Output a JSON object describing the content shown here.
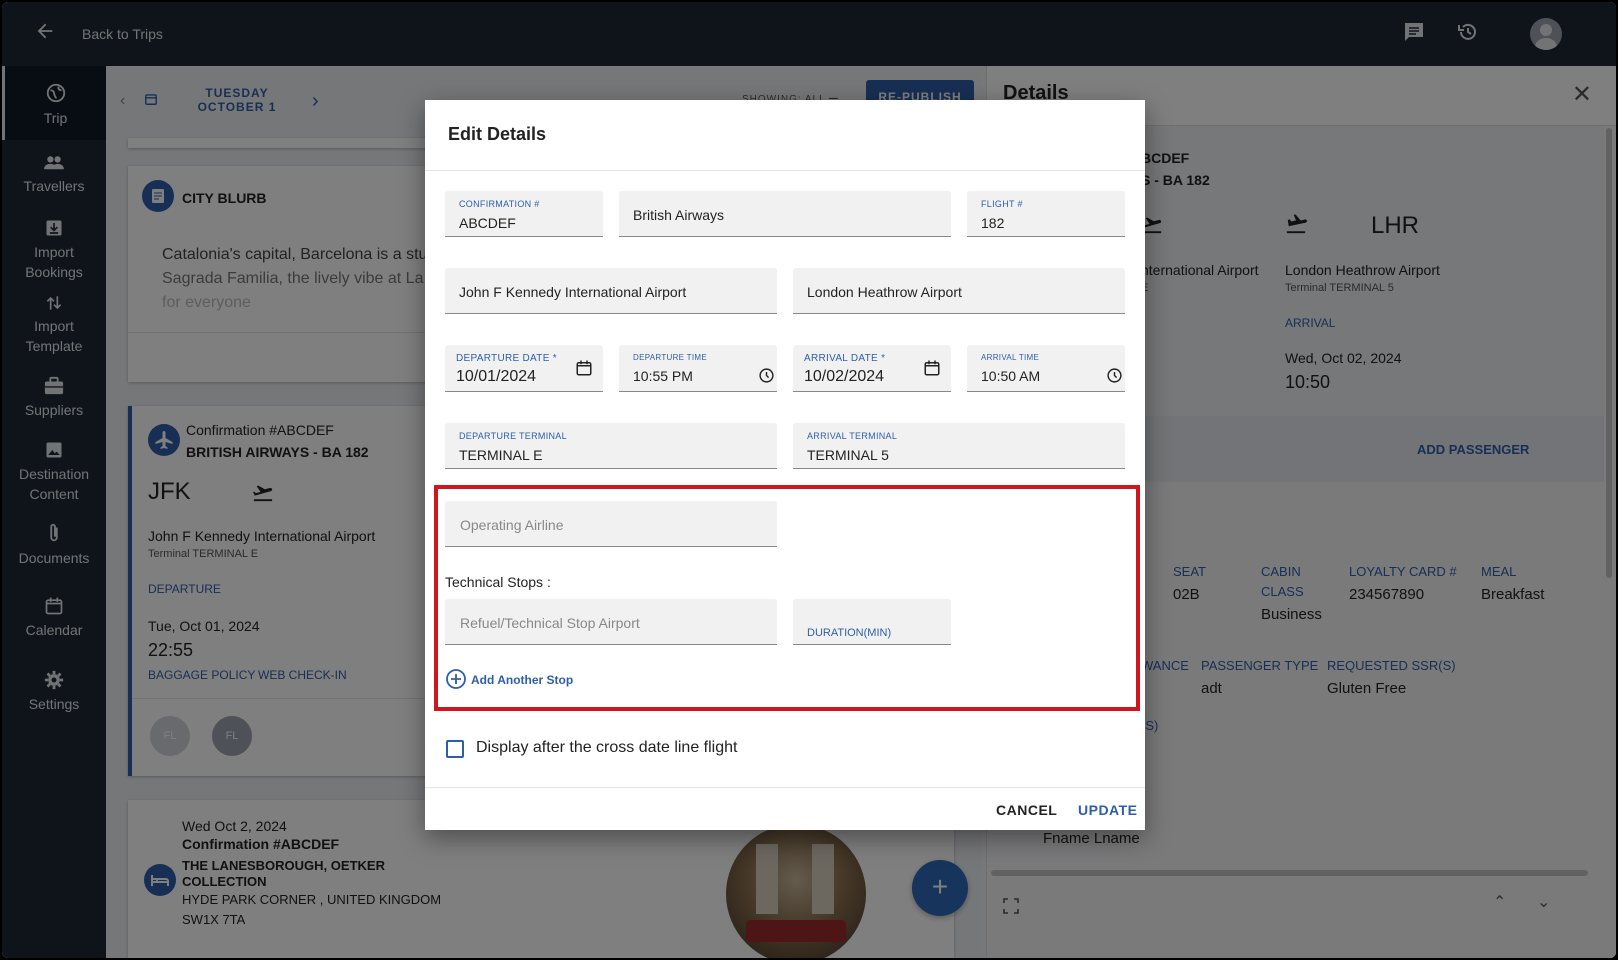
{
  "topbar": {
    "back_label": "Back to Trips"
  },
  "sidebar": {
    "items": [
      {
        "label": "Trip",
        "icon": "globe-icon"
      },
      {
        "label": "Travellers",
        "icon": "people-icon"
      },
      {
        "label": "Import Bookings",
        "icon": "import-icon"
      },
      {
        "label": "Import Template",
        "icon": "swap-vertical-icon"
      },
      {
        "label": "Suppliers",
        "icon": "briefcase-icon"
      },
      {
        "label": "Destination Content",
        "icon": "image-icon"
      },
      {
        "label": "Documents",
        "icon": "paperclip-icon"
      },
      {
        "label": "Calendar",
        "icon": "calendar-icon"
      },
      {
        "label": "Settings",
        "icon": "gear-icon"
      }
    ]
  },
  "main": {
    "date_label": "TUESDAY OCTOBER 1",
    "showing": "SHOWING: ALL",
    "republish": "RE-PUBLISH",
    "city_blurb": {
      "title": "CITY BLURB",
      "line1": "Catalonia's capital, Barcelona is a stun",
      "line2": "Sagrada Familia, the lively vibe at La R",
      "line3": "for everyone"
    },
    "flight": {
      "confirmation": "Confirmation #ABCDEF",
      "carrier": "BRITISH AIRWAYS - BA 182",
      "code": "JFK",
      "airport": "John F Kennedy International Airport",
      "terminal": "Terminal TERMINAL E",
      "type": "DEPARTURE",
      "date": "Tue, Oct 01, 2024",
      "time": "22:55",
      "baggage": "BAGGAGE POLICY",
      "checkin": "WEB CHECK-IN",
      "avatar1": "FL",
      "avatar2": "FL"
    },
    "hotel": {
      "date": "Wed Oct 2, 2024",
      "confirmation": "Confirmation #ABCDEF",
      "name1": "THE LANESBOROUGH, OETKER",
      "name2": "COLLECTION",
      "addr1": "HYDE PARK CORNER , UNITED KINGDOM",
      "addr2": "SW1X 7TA"
    },
    "fab": "+"
  },
  "details": {
    "title": "Details",
    "conf": "BCDEF",
    "flight": "S - BA 182",
    "arr_code": "LHR",
    "dep_airport_partial": "nternational Airport",
    "dep_terminal_partial": "E",
    "arr_airport": "London Heathrow Airport",
    "arr_terminal": "Terminal TERMINAL 5",
    "arrival_label": "ARRIVAL",
    "arr_date": "Wed, Oct 02, 2024",
    "arr_time": "10:50",
    "add_passenger": "ADD PASSENGER",
    "seat_label": "SEAT",
    "seat": "02B",
    "cabin_label1": "CABIN",
    "cabin_label2": "CLASS",
    "cabin": "Business",
    "loyalty_label": "LOYALTY CARD #",
    "loyalty": "234567890",
    "meal_label": "MEAL",
    "meal": "Breakfast",
    "allowance_partial": "WANCE",
    "ptype_label": "PASSENGER TYPE",
    "ptype": "adt",
    "ssr_label": "REQUESTED SSR(S)",
    "ssr": "Gluten Free",
    "s_partial": "(S)",
    "pax_name": "Fname Lname"
  },
  "modal": {
    "title": "Edit Details",
    "confirmation": {
      "label": "CONFIRMATION #",
      "value": "ABCDEF"
    },
    "airline": {
      "value": "British Airways"
    },
    "flight": {
      "label": "FLIGHT #",
      "value": "182"
    },
    "from_airport": {
      "value": "John F Kennedy International Airport"
    },
    "to_airport": {
      "value": "London Heathrow Airport"
    },
    "dep_date": {
      "label": "DEPARTURE DATE *",
      "value": "10/01/2024"
    },
    "dep_time": {
      "label": "DEPARTURE TIME",
      "value": "10:55 PM"
    },
    "arr_date": {
      "label": "ARRIVAL DATE *",
      "value": "10/02/2024"
    },
    "arr_time": {
      "label": "ARRIVAL TIME",
      "value": "10:50 AM"
    },
    "dep_terminal": {
      "label": "DEPARTURE TERMINAL",
      "value": "TERMINAL E"
    },
    "arr_terminal": {
      "label": "ARRIVAL TERMINAL",
      "value": "TERMINAL 5"
    },
    "operating_airline": {
      "placeholder": "Operating Airline"
    },
    "technical_stops_label": "Technical Stops :",
    "stop_airport": {
      "placeholder": "Refuel/Technical Stop Airport"
    },
    "stop_duration": {
      "label": "DURATION(MIN)"
    },
    "add_stop": "Add Another Stop",
    "cross_date_line": "Display after the cross date line flight",
    "cancel": "CANCEL",
    "update": "UPDATE"
  },
  "colors": {
    "accent": "#2f5ea8",
    "sidebar": "#1f2937",
    "highlight": "#d0161c"
  }
}
